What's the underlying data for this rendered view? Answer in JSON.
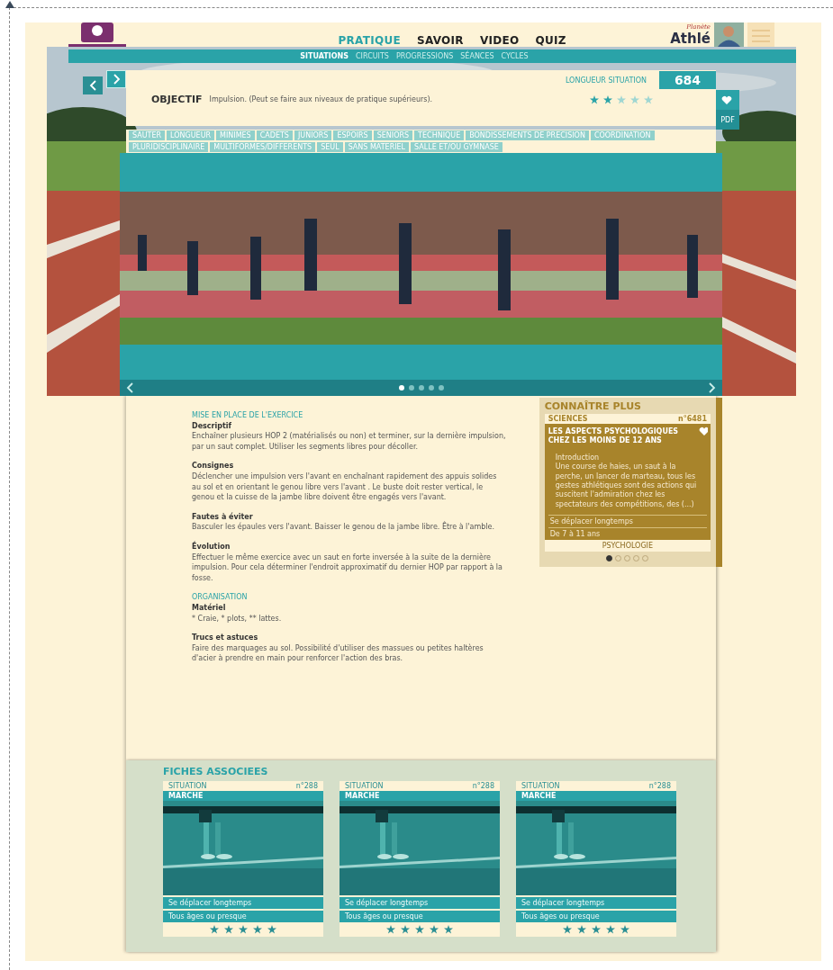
{
  "header": {
    "nav": [
      {
        "label": "PRATIQUE",
        "selected": true
      },
      {
        "label": "SAVOIR",
        "selected": false
      },
      {
        "label": "VIDEO",
        "selected": false
      },
      {
        "label": "QUIZ",
        "selected": false
      }
    ],
    "subnav": [
      {
        "label": "SITUATIONS",
        "selected": true
      },
      {
        "label": "CIRCUITS",
        "selected": false
      },
      {
        "label": "PROGRESSIONS",
        "selected": false
      },
      {
        "label": "SÉANCES",
        "selected": false
      },
      {
        "label": "CYCLES",
        "selected": false
      }
    ],
    "brand": {
      "tagline": "Planète",
      "name": "Athlé"
    }
  },
  "situation": {
    "length_label": "LONGUEUR SITUATION",
    "number": "684",
    "objective_label": "OBJECTIF",
    "objective": "Impulsion. (Peut se faire aux niveaux de pratique supérieurs).",
    "stars": 2,
    "pdf_label": "PDF",
    "tags": [
      "SAUTER",
      "LONGUEUR",
      "MINIMES",
      "CADETS",
      "JUNIORS",
      "ESPOIRS",
      "SENIORS",
      "TECHNIQUE",
      "BONDISSEMENTS DE PRECISION",
      "COORDINATION",
      "PLURIDISCIPLINAIRE",
      "MULTIFORMES/DIFFERENTS",
      "SEUL",
      "SANS MATERIEL",
      "SALLE ET/OU GYMNASE"
    ]
  },
  "slider": {
    "dots": [
      {
        "selected": true
      },
      {
        "selected": false
      },
      {
        "selected": false
      },
      {
        "selected": false
      },
      {
        "selected": false
      }
    ]
  },
  "details": [
    {
      "title": "MISE EN PLACE DE L'EXERCICE",
      "items": [
        {
          "heading": "Descriptif",
          "text": "Enchaîner plusieurs HOP 2 (matérialisés ou non) et terminer, sur la dernière impulsion, par un saut complet. Utiliser les segments libres pour décoller."
        },
        {
          "heading": "Consignes",
          "text": "Déclencher une impulsion vers l'avant en enchaînant rapidement des appuis solides au sol et en orientant le genou libre vers l'avant . Le buste doit rester vertical, le genou et la cuisse de la jambe libre doivent être engagés vers l'avant."
        },
        {
          "heading": "Fautes à éviter",
          "text": "Basculer les épaules vers l'avant. Baisser le genou de la jambe libre. Être à l'amble."
        },
        {
          "heading": "Évolution",
          "text": "Effectuer le même exercice avec un saut en forte inversée à la suite de la dernière impulsion. Pour cela déterminer l'endroit approximatif du dernier HOP par rapport à la fosse."
        }
      ]
    },
    {
      "title": "ORGANISATION",
      "items": [
        {
          "heading": "Matériel",
          "text": "* Craie, * plots, ** lattes."
        },
        {
          "heading": "Trucs et astuces",
          "text": "Faire des marquages au sol. Possibilité d'utiliser des massues ou petites haltères d'acier à prendre en main pour renforcer l'action des bras."
        }
      ]
    }
  ],
  "sidebar": {
    "title": "CONNAÎTRE PLUS",
    "category": "SCIENCES",
    "number": "n°6481",
    "card_title": "LES ASPECTS PSYCHOLOGIQUES CHEZ LES MOINS DE 12 ANS",
    "intro": "Introduction",
    "excerpt": "Une course de haies, un saut à la perche, un lancer de marteau, tous les gestes athlétiques sont des actions qui suscitent l'admiration chez les spectateurs des compétitions, des (...)",
    "meta": [
      "Se déplacer longtemps",
      "De 7 à 11 ans"
    ],
    "footer": "PSYCHOLOGIE",
    "dots": [
      {
        "selected": true
      },
      {
        "selected": false
      },
      {
        "selected": false
      },
      {
        "selected": false
      },
      {
        "selected": false
      }
    ]
  },
  "related": {
    "title": "FICHES ASSOCIEES",
    "cards": [
      {
        "category": "SITUATION",
        "number": "n°288",
        "title": "MARCHE",
        "meta": [
          "Se déplacer longtemps",
          "Tous âges ou presque"
        ],
        "stars": 5
      },
      {
        "category": "SITUATION",
        "number": "n°288",
        "title": "MARCHE",
        "meta": [
          "Se déplacer longtemps",
          "Tous âges ou presque"
        ],
        "stars": 5
      },
      {
        "category": "SITUATION",
        "number": "n°288",
        "title": "MARCHE",
        "meta": [
          "Se déplacer longtemps",
          "Tous âges ou presque"
        ],
        "stars": 5
      }
    ]
  }
}
